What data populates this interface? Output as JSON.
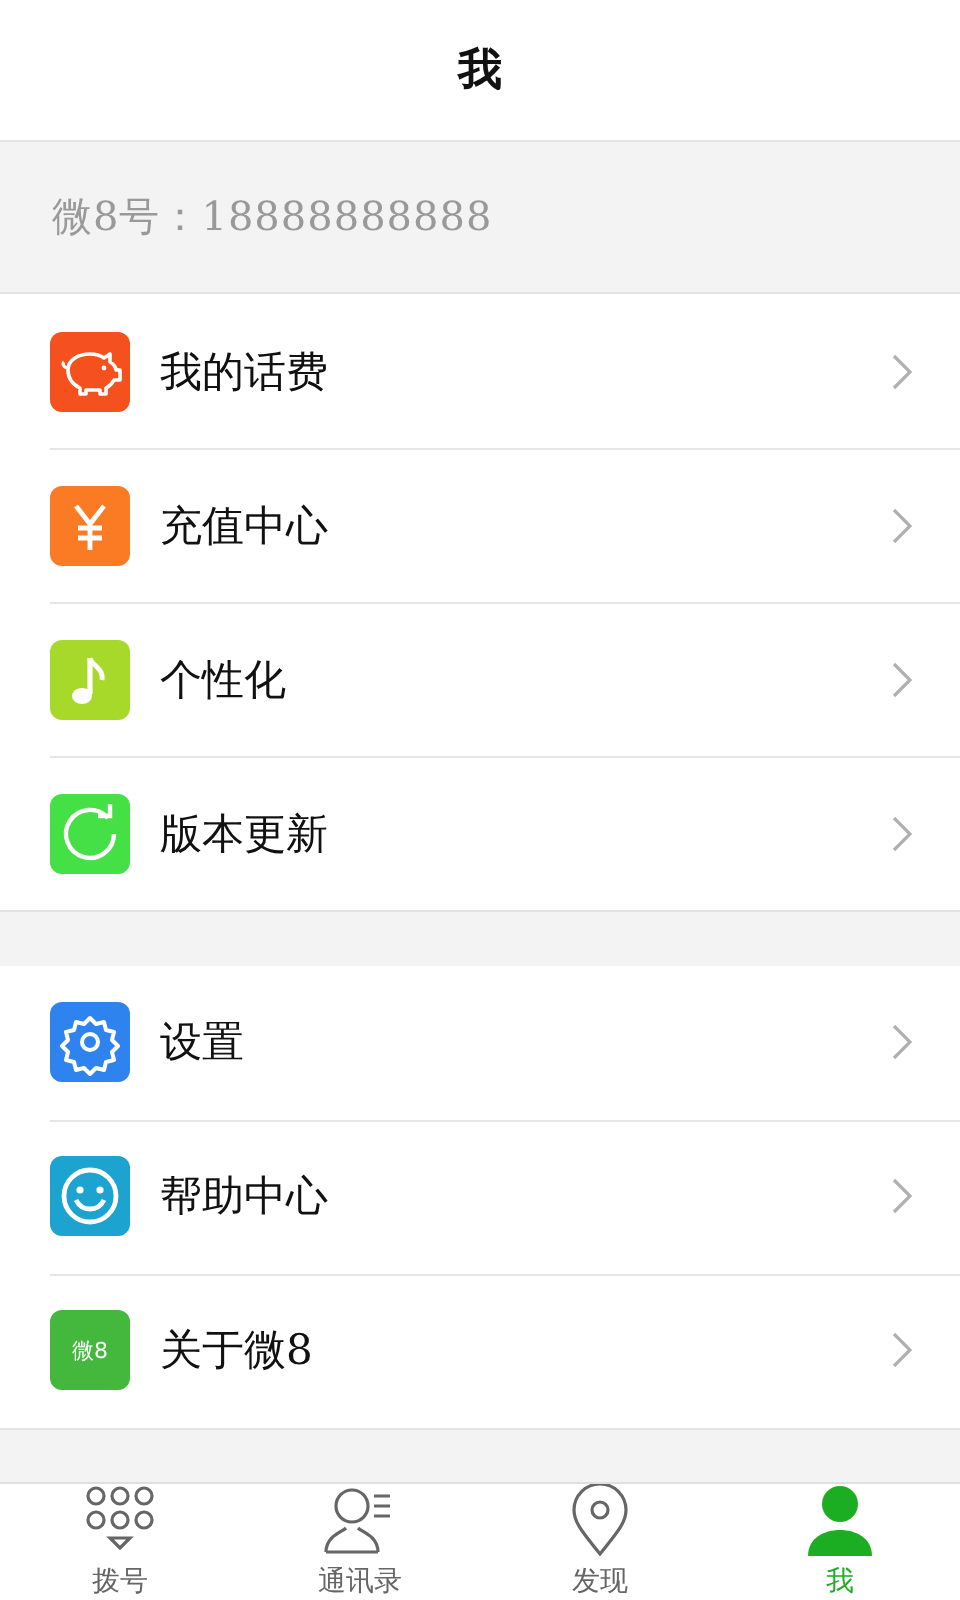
{
  "header": {
    "title": "我"
  },
  "account": {
    "label": "微8号：18888888888"
  },
  "groups": [
    {
      "items": [
        {
          "label": "我的话费",
          "kind": "piggy",
          "color": "#f4511e"
        },
        {
          "label": "充值中心",
          "kind": "yen",
          "color": "#fb7a24"
        },
        {
          "label": "个性化",
          "kind": "note",
          "color": "#a6d92a"
        },
        {
          "label": "版本更新",
          "kind": "refresh",
          "color": "#45e046"
        }
      ]
    },
    {
      "items": [
        {
          "label": "设置",
          "kind": "gear",
          "color": "#2f83ee"
        },
        {
          "label": "帮助中心",
          "kind": "smile",
          "color": "#1ca3cf"
        },
        {
          "label": "关于微8",
          "kind": "badge",
          "color": "#43b83d",
          "icon_text": "微8"
        }
      ]
    }
  ],
  "tabs": [
    {
      "label": "拨号",
      "kind": "dialpad",
      "selected": false
    },
    {
      "label": "通讯录",
      "kind": "contacts",
      "selected": false
    },
    {
      "label": "发现",
      "kind": "pin",
      "selected": false
    },
    {
      "label": "我",
      "kind": "person",
      "selected": true
    }
  ]
}
